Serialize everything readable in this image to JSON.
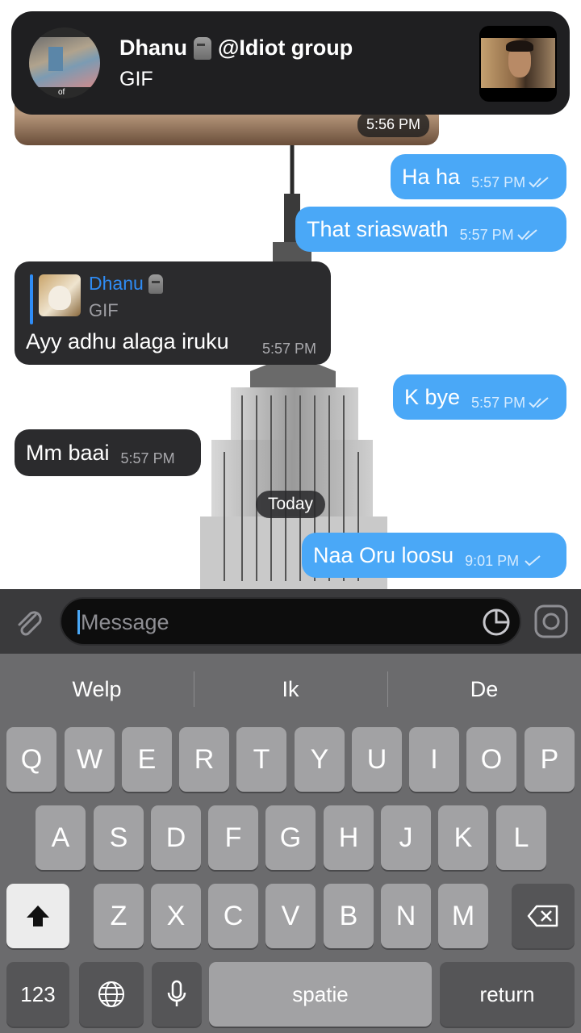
{
  "notification": {
    "sender": "Dhanu",
    "group": "@Idiot group",
    "preview": "GIF",
    "avatar_label": "of"
  },
  "chat": {
    "gif_time": "5:56 PM",
    "messages": [
      {
        "dir": "out",
        "text": "Ha ha",
        "time": "5:57 PM",
        "status": "read"
      },
      {
        "dir": "out",
        "text": "That sriaswath",
        "time": "5:57 PM",
        "status": "read"
      },
      {
        "dir": "in",
        "reply_name": "Dhanu",
        "reply_sub": "GIF",
        "text": "Ayy adhu alaga iruku",
        "time": "5:57 PM"
      },
      {
        "dir": "out",
        "text": "K bye",
        "time": "5:57 PM",
        "status": "read"
      },
      {
        "dir": "in",
        "text": "Mm baai",
        "time": "5:57 PM"
      },
      {
        "dir": "out",
        "text": "Naa Oru loosu",
        "time": "9:01 PM",
        "status": "sent"
      }
    ],
    "date_divider": "Today"
  },
  "composer": {
    "placeholder": "Message"
  },
  "keyboard": {
    "suggestions": [
      "Welp",
      "Ik",
      "De"
    ],
    "row1": [
      "Q",
      "W",
      "E",
      "R",
      "T",
      "Y",
      "U",
      "I",
      "O",
      "P"
    ],
    "row2": [
      "A",
      "S",
      "D",
      "F",
      "G",
      "H",
      "J",
      "K",
      "L"
    ],
    "row3": [
      "Z",
      "X",
      "C",
      "V",
      "B",
      "N",
      "M"
    ],
    "numbers_label": "123",
    "space_label": "spatie",
    "return_label": "return"
  },
  "colors": {
    "outgoing": "#4aa8f7",
    "incoming": "#2b2b2d",
    "accent": "#2f8cf5"
  }
}
